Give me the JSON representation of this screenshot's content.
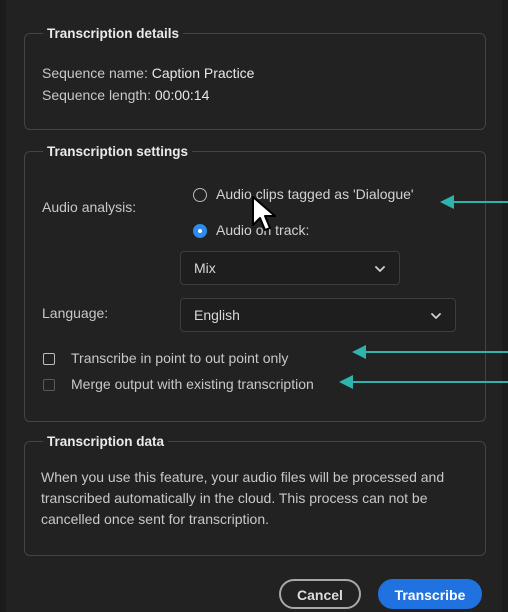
{
  "details": {
    "title": "Transcription details",
    "seq_name_label": "Sequence name: ",
    "seq_name_value": "Caption Practice",
    "seq_length_label": "Sequence length: ",
    "seq_length_value": "00:00:14"
  },
  "settings": {
    "title": "Transcription settings",
    "audio_analysis_label": "Audio analysis:",
    "radio_dialogue": "Audio clips tagged as 'Dialogue'",
    "radio_track": "Audio on track:",
    "track_select_value": "Mix",
    "language_label": "Language:",
    "language_value": "English",
    "checkbox_in_out": "Transcribe in point to out point only",
    "checkbox_merge": "Merge output with existing transcription"
  },
  "data_section": {
    "title": "Transcription data",
    "text": "When you use this feature, your audio files will be processed and transcribed automatically in the cloud. This process can not be cancelled once sent for transcription."
  },
  "buttons": {
    "cancel": "Cancel",
    "transcribe": "Transcribe"
  },
  "colors": {
    "accent": "#1f72e0",
    "annotation_arrow": "#2fb3ad"
  }
}
